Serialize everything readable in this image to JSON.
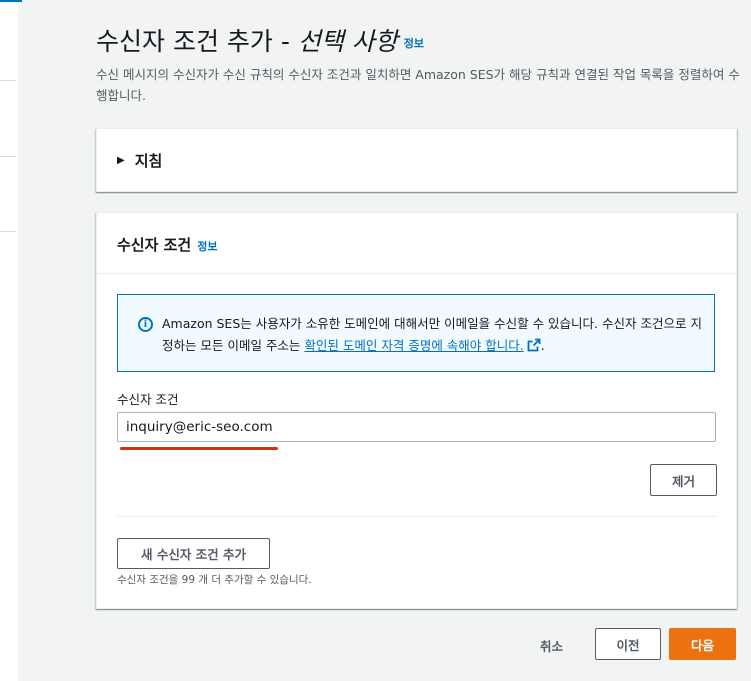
{
  "header": {
    "title": "수신자 조건 추가 - ",
    "title_optional": "선택 사항",
    "info_label": "정보",
    "description": "수신 메시지의 수신자가 수신 규칙의 수신자 조건과 일치하면 Amazon SES가 해당 규칙과 연결된 작업 목록을 정렬하여 수행합니다."
  },
  "guide_panel": {
    "caret": "▶",
    "title": "지침"
  },
  "conditions_panel": {
    "title": "수신자 조건",
    "info_label": "정보",
    "alert": {
      "icon": "info-icon",
      "text_before": "Amazon SES는 사용자가 소유한 도메인에 대해서만 이메일을 수신할 수 있습니다. 수신자 조건으로 지정하는 모든 이메일 주소는 ",
      "link_text": "확인된 도메인 자격 증명에 속해야 합니다.",
      "text_after": "."
    },
    "field_label": "수신자 조건",
    "field_value": "inquiry@eric-seo.com",
    "remove_label": "제거",
    "add_label": "새 수신자 조건 추가",
    "hint": "수신자 조건을 99 개 더 추가할 수 있습니다."
  },
  "footer": {
    "cancel_label": "취소",
    "prev_label": "이전",
    "next_label": "다음"
  },
  "colors": {
    "primary": "#ec7211",
    "link": "#0073bb",
    "annotation": "#d13212"
  }
}
